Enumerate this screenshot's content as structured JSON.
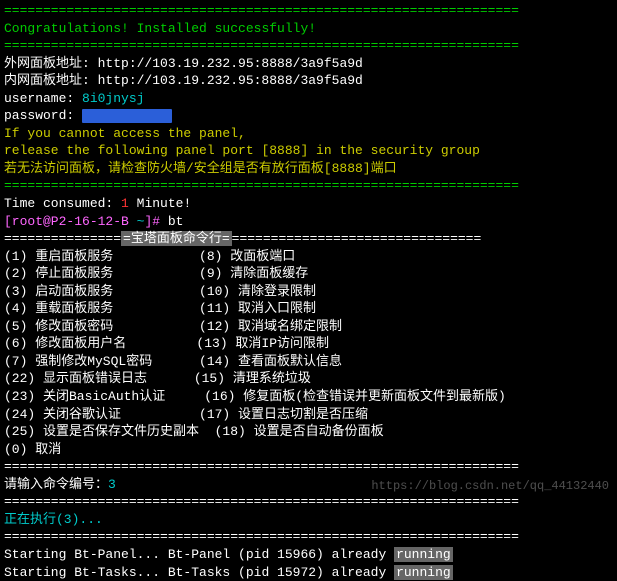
{
  "divider": "==================================================================",
  "congrats": "Congratulations! Installed successfully!",
  "panel1_label": "外网面板地址: ",
  "panel1_url": "http://103.19.232.95:8888/3a9f5a9d",
  "panel2_label": "内网面板地址: ",
  "panel2_url": "http://103.19.232.95:8888/3a9f5a9d",
  "username_label": "username: ",
  "username_value": "8i0jnysj",
  "password_label": "password: ",
  "warn1": "If you cannot access the panel,",
  "warn2": "release the following panel port [8888] in the security group",
  "warn3": "若无法访问面板，请检查防火墙/安全组是否有放行面板[8888]端口",
  "time_consumed_label": "Time consumed: ",
  "time_value": "1",
  "time_unit": " Minute!",
  "prompt_user": "[root@P2-16-12-B ",
  "prompt_sym": "~",
  "prompt_end": "]# ",
  "prompt_cmd": "bt",
  "menu_title": "=宝塔面板命令行=",
  "menu_divider_left": "===============",
  "menu_divider_right": "================================",
  "menu": [
    "(1) 重启面板服务           (8) 改面板端口",
    "(2) 停止面板服务           (9) 清除面板缓存",
    "(3) 启动面板服务           (10) 清除登录限制",
    "(4) 重载面板服务           (11) 取消入口限制",
    "(5) 修改面板密码           (12) 取消域名绑定限制",
    "(6) 修改面板用户名         (13) 取消IP访问限制",
    "(7) 强制修改MySQL密码      (14) 查看面板默认信息",
    "(22) 显示面板错误日志      (15) 清理系统垃圾",
    "(23) 关闭BasicAuth认证     (16) 修复面板(检查错误并更新面板文件到最新版)",
    "(24) 关闭谷歌认证          (17) 设置日志切割是否压缩",
    "(25) 设置是否保存文件历史副本  (18) 设置是否自动备份面板",
    "(0) 取消"
  ],
  "input_prompt": "请输入命令编号：",
  "input_value": "3",
  "executing": "正在执行(3)...",
  "start1_a": "Starting Bt-Panel... Bt-Panel (pid 15966) already ",
  "start1_b": "running",
  "start2_a": "Starting Bt-Tasks... Bt-Tasks (pid 15972) already ",
  "start2_b": "running",
  "watermark": "https://blog.csdn.net/qq_44132440"
}
